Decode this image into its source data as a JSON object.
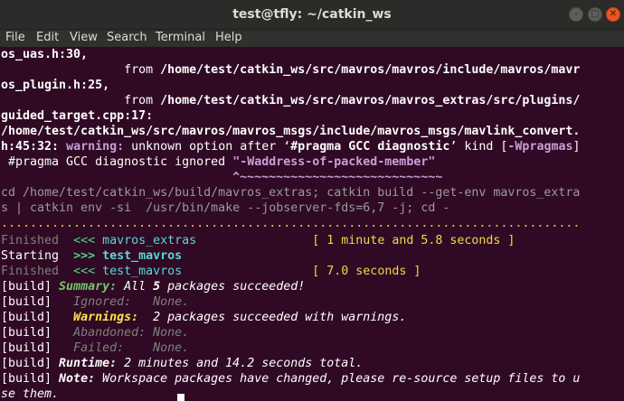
{
  "window": {
    "title": "test@tfly: ~/catkin_ws",
    "buttons": {
      "minimize_icon": "–",
      "maximize_icon": "□",
      "close_icon": "✕"
    }
  },
  "menu": {
    "file": "File",
    "edit": "Edit",
    "view": "View",
    "search": "Search",
    "terminal": "Terminal",
    "help": "Help"
  },
  "colors": {
    "terminal_bg": "#300a24",
    "titlebar_bg": "#2b2b29",
    "close_button": "#e95420",
    "green": "#4fd38a",
    "yellow": "#f3d544",
    "cyan": "#5ad7d7",
    "magenta": "#c6a0d6"
  },
  "terminal": {
    "l1": "os_uas.h:30,",
    "l2a": "                 from ",
    "l2b": "/home/test/catkin_ws/src/mavros/mavros/include/mavros/mavr",
    "l3": "os_plugin.h:25,",
    "l4a": "                 from ",
    "l4b": "/home/test/catkin_ws/src/mavros/mavros_extras/src/plugins/",
    "l5": "guided_target.cpp:17:",
    "l6": "/home/test/catkin_ws/src/mavros/mavros_msgs/include/mavros_msgs/mavlink_convert.",
    "l7a": "h:45:32: ",
    "l7b": "warning: ",
    "l7c": "unknown option after ‘",
    "l7d": "#pragma GCC diagnostic",
    "l7e": "’ kind [",
    "l7f": "-Wpragmas",
    "l7g": "]",
    "l8a": " #pragma GCC diagnostic ignored ",
    "l8b": "\"-Waddress-of-packed-member\"",
    "l9": "                                ^~~~~~~~~~~~~~~~~~~~~~~~~~~~~",
    "l10": "cd /home/test/catkin_ws/build/mavros_extras; catkin build --get-env mavros_extra",
    "l11": "s | catkin env -si  /usr/bin/make --jobserver-fds=6,7 -j; cd -",
    "l12": "................................................................................",
    "l13a": "Finished  ",
    "l13b": "<<< ",
    "l13c": "mavros_extras",
    "l13d": "                ",
    "l13e": "[ 1 minute and 5.8 seconds ]",
    "l14a": "Starting  ",
    "l14b": ">>> ",
    "l14c": "test_mavros",
    "l15a": "Finished  ",
    "l15b": "<<< ",
    "l15c": "test_mavros",
    "l15d": "                  ",
    "l15e": "[ 7.0 seconds ]",
    "l16a": "[build] ",
    "l16b": "Summary:",
    "l16c": " All ",
    "l16d": "5",
    "l16e": " packages succeeded!",
    "l17a": "[build]   ",
    "l17b": "Ignored:   None.",
    "l18a": "[build]   ",
    "l18b": "Warnings:",
    "l18c": "  2 packages succeeded with warnings.",
    "l19a": "[build]   ",
    "l19b": "Abandoned: None.",
    "l20a": "[build]   ",
    "l20b": "Failed:    None.",
    "l21a": "[build] ",
    "l21b": "Runtime:",
    "l21c": " 2 minutes and 14.2 seconds total.",
    "l22a": "[build] ",
    "l22b": "Note:",
    "l22c": " Workspace packages have changed, please re-source setup files to u",
    "l23": "se them."
  }
}
